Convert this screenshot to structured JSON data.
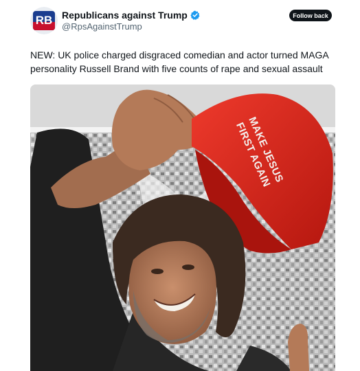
{
  "account": {
    "display_name": "Republicans against Trump",
    "handle": "@RpsAgainstTrump",
    "avatar_text": "RB",
    "verified_icon": "verified-badge-icon"
  },
  "actions": {
    "follow_label": "Follow back"
  },
  "tweet": {
    "text": "NEW: UK police charged disgraced comedian and actor turned MAGA personality Russell Brand with five counts of rape and sexual assault"
  },
  "media": {
    "hat_text_line1": "MAKE JESUS",
    "hat_text_line2": "FIRST AGAIN"
  },
  "colors": {
    "verified": "#1d9bf0",
    "follow_button": "#0f1419",
    "hat_red": "#d8261f"
  }
}
